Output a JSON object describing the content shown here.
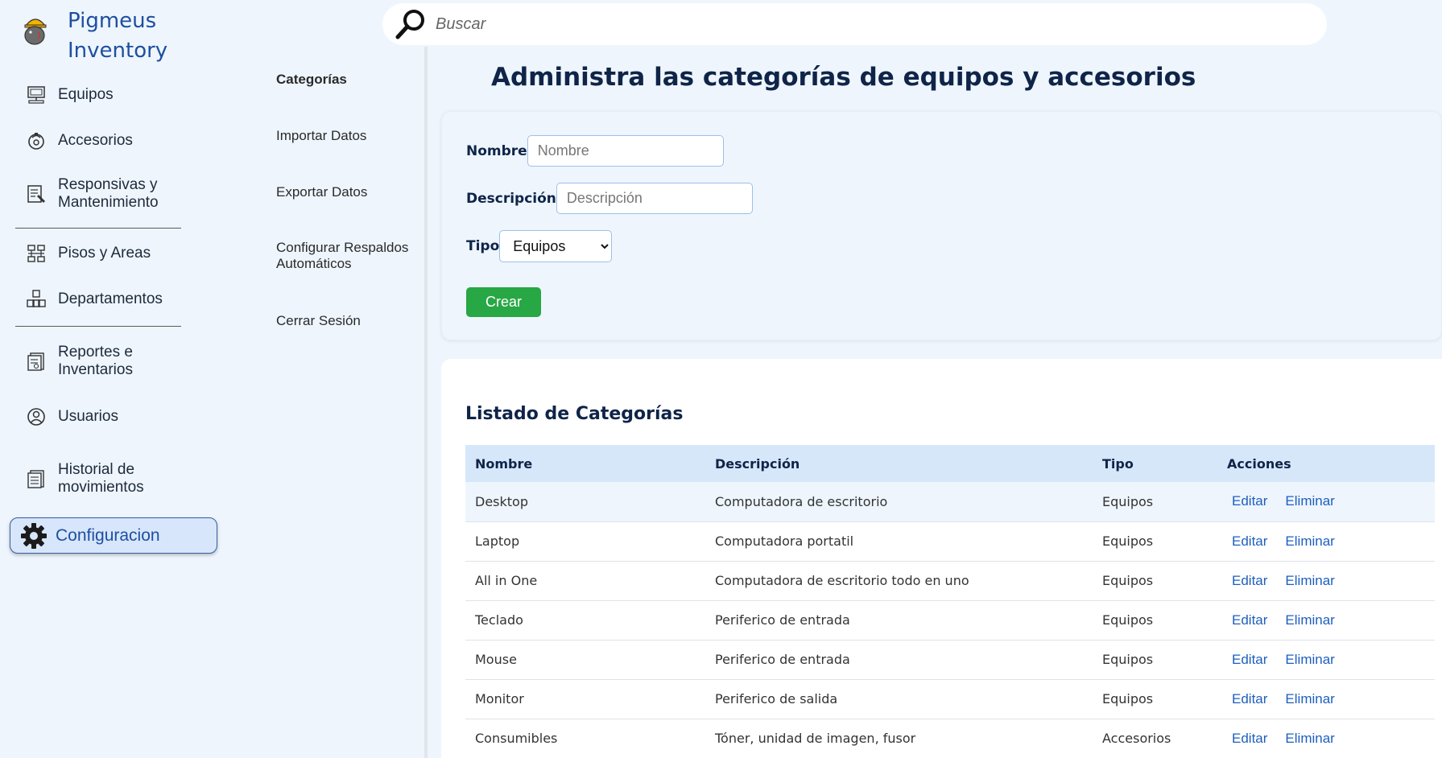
{
  "app": {
    "title_line1": "Pigmeus",
    "title_line2": "Inventory"
  },
  "search": {
    "placeholder": "Buscar"
  },
  "nav": {
    "items": [
      {
        "label": "Equipos",
        "icon": "computer-icon"
      },
      {
        "label": "Accesorios",
        "icon": "accessories-icon"
      },
      {
        "label": "Responsivas y Mantenimiento",
        "icon": "maintenance-icon"
      },
      {
        "label": "Pisos y Areas",
        "icon": "floors-icon"
      },
      {
        "label": "Departamentos",
        "icon": "departments-icon"
      },
      {
        "label": "Reportes e Inventarios",
        "icon": "reports-icon"
      },
      {
        "label": "Usuarios",
        "icon": "user-icon"
      },
      {
        "label": "Historial de movimientos",
        "icon": "history-icon"
      }
    ],
    "active": {
      "label": "Configuracion",
      "icon": "gear-icon"
    }
  },
  "submenu": {
    "items": [
      {
        "label": "Categorías"
      },
      {
        "label": "Importar Datos"
      },
      {
        "label": "Exportar Datos"
      },
      {
        "label": "Configurar Respaldos Automáticos"
      },
      {
        "label": "Cerrar Sesión"
      }
    ]
  },
  "main": {
    "title": "Administra las categorías de equipos y accesorios",
    "form": {
      "name_label": "Nombre",
      "name_placeholder": "Nombre",
      "desc_label": "Descripción",
      "desc_placeholder": "Descripción",
      "type_label": "Tipo",
      "type_selected": "Equipos",
      "create_label": "Crear"
    },
    "list": {
      "title": "Listado de Categorías",
      "columns": [
        "Nombre",
        "Descripción",
        "Tipo",
        "Acciones"
      ],
      "edit_label": "Editar",
      "delete_label": "Eliminar",
      "rows": [
        {
          "name": "Desktop",
          "description": "Computadora de escritorio",
          "type": "Equipos"
        },
        {
          "name": "Laptop",
          "description": "Computadora portatil",
          "type": "Equipos"
        },
        {
          "name": "All in One",
          "description": "Computadora de escritorio todo en uno",
          "type": "Equipos"
        },
        {
          "name": "Teclado",
          "description": "Periferico de entrada",
          "type": "Equipos"
        },
        {
          "name": "Mouse",
          "description": "Periferico de entrada",
          "type": "Equipos"
        },
        {
          "name": "Monitor",
          "description": "Periferico de salida",
          "type": "Equipos"
        },
        {
          "name": "Consumibles",
          "description": "Tóner, unidad de imagen, fusor",
          "type": "Accesorios"
        }
      ]
    }
  }
}
